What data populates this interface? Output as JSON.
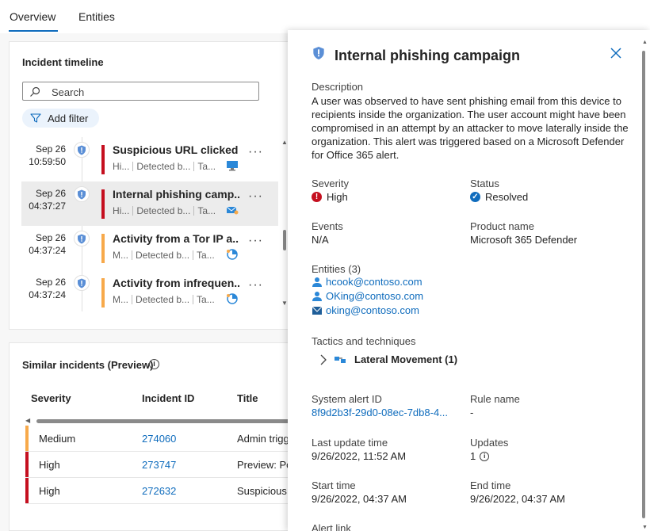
{
  "tabs": [
    {
      "label": "Overview"
    },
    {
      "label": "Entities"
    }
  ],
  "timeline": {
    "title": "Incident timeline",
    "search_placeholder": "Search",
    "add_filter": "Add filter",
    "items": [
      {
        "date": "Sep 26",
        "time": "10:59:50",
        "title": "Suspicious URL clicked",
        "sev": "Hi...",
        "detected": "Detected b...",
        "ta": "Ta...",
        "color": "#c50f1f"
      },
      {
        "date": "Sep 26",
        "time": "04:37:27",
        "title": "Internal phishing camp...",
        "sev": "Hi...",
        "detected": "Detected b...",
        "ta": "Ta...",
        "color": "#c50f1f"
      },
      {
        "date": "Sep 26",
        "time": "04:37:24",
        "title": "Activity from a Tor IP a...",
        "sev": "M...",
        "detected": "Detected b...",
        "ta": "Ta...",
        "color": "#f7a94a"
      },
      {
        "date": "Sep 26",
        "time": "04:37:24",
        "title": "Activity from infrequen...",
        "sev": "M...",
        "detected": "Detected b...",
        "ta": "Ta...",
        "color": "#f7a94a"
      }
    ],
    "more": "···"
  },
  "similar": {
    "title": "Similar incidents (Preview)",
    "info": "i",
    "headers": [
      "Severity",
      "Incident ID",
      "Title"
    ],
    "rows": [
      {
        "severity": "Medium",
        "id": "274060",
        "title": "Admin trigg",
        "color": "#f7a94a"
      },
      {
        "severity": "High",
        "id": "273747",
        "title": "Preview: Po",
        "color": "#c50f1f"
      },
      {
        "severity": "High",
        "id": "272632",
        "title": "Suspicious",
        "color": "#c50f1f"
      }
    ]
  },
  "panel": {
    "title": "Internal phishing campaign",
    "description_label": "Description",
    "description": "A user was observed to have sent phishing email from this device to recipients inside the organization. The user account might have been compromised in an attempt by an attacker to move laterally inside the organization. This alert was triggered based on a Microsoft Defender for Office 365 alert.",
    "severity_label": "Severity",
    "severity_value": "High",
    "status_label": "Status",
    "status_value": "Resolved",
    "events_label": "Events",
    "events_value": "N/A",
    "product_label": "Product name",
    "product_value": "Microsoft 365 Defender",
    "entities_label": "Entities (3)",
    "entities": [
      "hcook@contoso.com",
      "OKing@contoso.com",
      "oking@contoso.com"
    ],
    "tactics_label": "Tactics and techniques",
    "tactic": "Lateral Movement (1)",
    "system_alert_label": "System alert ID",
    "system_alert_value": "8f9d2b3f-29d0-08ec-7db8-4...",
    "rule_label": "Rule name",
    "rule_value": "-",
    "last_update_label": "Last update time",
    "last_update_value": "9/26/2022, 11:52 AM",
    "updates_label": "Updates",
    "updates_value": "1",
    "start_label": "Start time",
    "start_value": "9/26/2022, 04:37 AM",
    "end_label": "End time",
    "end_value": "9/26/2022, 04:37 AM",
    "alert_link_label": "Alert link"
  }
}
